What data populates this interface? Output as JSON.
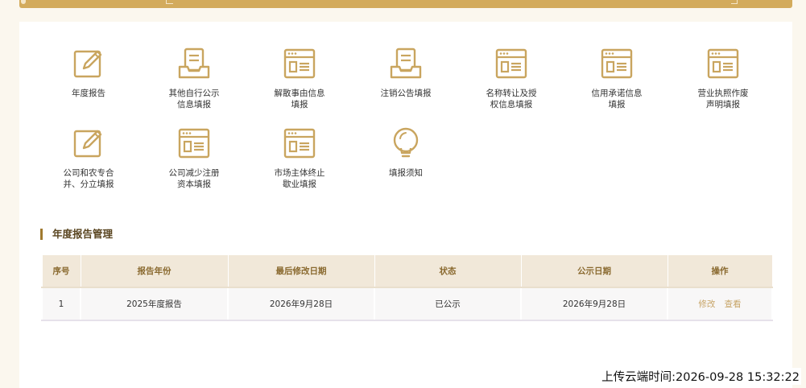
{
  "accent_color": "#c9a55f",
  "tiles": [
    {
      "icon": "edit-form-icon",
      "label": "年度报告"
    },
    {
      "icon": "tray-document-icon",
      "label": "其他自行公示\n信息填报"
    },
    {
      "icon": "window-list-icon",
      "label": "解散事由信息\n填报"
    },
    {
      "icon": "tray-document-icon",
      "label": "注销公告填报"
    },
    {
      "icon": "window-list-icon",
      "label": "名称转让及授\n权信息填报"
    },
    {
      "icon": "window-list-icon",
      "label": "信用承诺信息\n填报"
    },
    {
      "icon": "window-list-icon",
      "label": "营业执照作废\n声明填报"
    },
    {
      "icon": "edit-form-icon",
      "label": "公司和农专合\n并、分立填报"
    },
    {
      "icon": "window-list-icon",
      "label": "公司减少注册\n资本填报"
    },
    {
      "icon": "window-list-icon",
      "label": "市场主体终止\n歇业填报"
    },
    {
      "icon": "lightbulb-icon",
      "label": "填报须知"
    }
  ],
  "section": {
    "title": "年度报告管理"
  },
  "table": {
    "headers": [
      "序号",
      "报告年份",
      "最后修改日期",
      "状态",
      "公示日期",
      "操作"
    ],
    "rows": [
      {
        "index": "1",
        "year": "2025年度报告",
        "modified": "2026年9月28日",
        "status": "已公示",
        "publish_date": "2026年9月28日",
        "actions": [
          "修改",
          "查看"
        ]
      }
    ]
  },
  "upload_time": "上传云端时间:2026-09-28 15:32:22"
}
